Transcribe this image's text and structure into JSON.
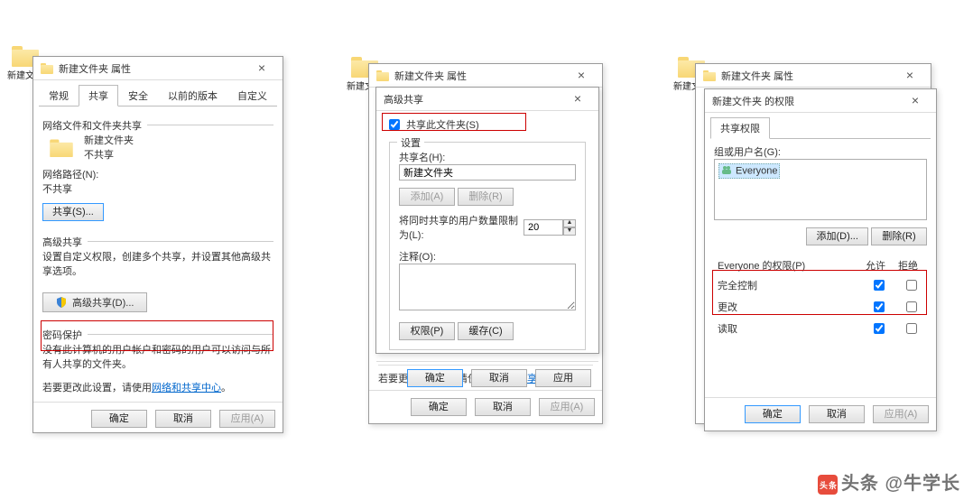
{
  "folder": {
    "label": "新建文件"
  },
  "dlg1": {
    "title": "新建文件夹 属性",
    "tabs": {
      "t0": "常规",
      "t1": "共享",
      "t2": "安全",
      "t3": "以前的版本",
      "t4": "自定义"
    },
    "netshare_heading": "网络文件和文件夹共享",
    "folder_name": "新建文件夹",
    "not_shared": "不共享",
    "netpath_label": "网络路径(N):",
    "netpath_value": "不共享",
    "share_btn": "共享(S)...",
    "adv_heading": "高级共享",
    "adv_desc": "设置自定义权限，创建多个共享，并设置其他高级共享选项。",
    "adv_btn": "高级共享(D)...",
    "pw_heading": "密码保护",
    "pw_text1": "没有此计算机的用户帐户和密码的用户可以访问与所有人共享的文件夹。",
    "pw_text2_a": "若要更改此设置，请使用",
    "pw_text2_link": "网络和共享中心",
    "ok": "确定",
    "cancel": "取消",
    "apply": "应用(A)"
  },
  "dlg2_back": {
    "title": "新建文件夹 属性"
  },
  "dlg2": {
    "title": "高级共享",
    "share_cb": "共享此文件夹(S)",
    "settings": "设置",
    "sharename_label": "共享名(H):",
    "sharename_value": "新建文件夹",
    "add": "添加(A)",
    "remove": "删除(R)",
    "limit_label": "将同时共享的用户数量限制为(L):",
    "limit_value": "20",
    "comment_label": "注释(O):",
    "perm": "权限(P)",
    "cache": "缓存(C)",
    "ok": "确定",
    "cancel": "取消",
    "apply": "应用",
    "under_text_a": "若要更改此设置，请使用",
    "under_text_link": "网络和共享中心",
    "back_ok": "确定",
    "back_cancel": "取消",
    "back_apply": "应用(A)"
  },
  "dlg3_back": {
    "title": "新建文件夹 属性"
  },
  "dlg3": {
    "title": "新建文件夹 的权限",
    "tab": "共享权限",
    "group_label": "组或用户名(G):",
    "user": "Everyone",
    "add": "添加(D)...",
    "remove": "删除(R)",
    "perm_header": "Everyone 的权限(P)",
    "col_allow": "允许",
    "col_deny": "拒绝",
    "perm_full": "完全控制",
    "perm_change": "更改",
    "perm_read": "读取",
    "ok": "确定",
    "cancel": "取消",
    "apply": "应用(A)"
  },
  "watermark": "头条 @牛学长"
}
